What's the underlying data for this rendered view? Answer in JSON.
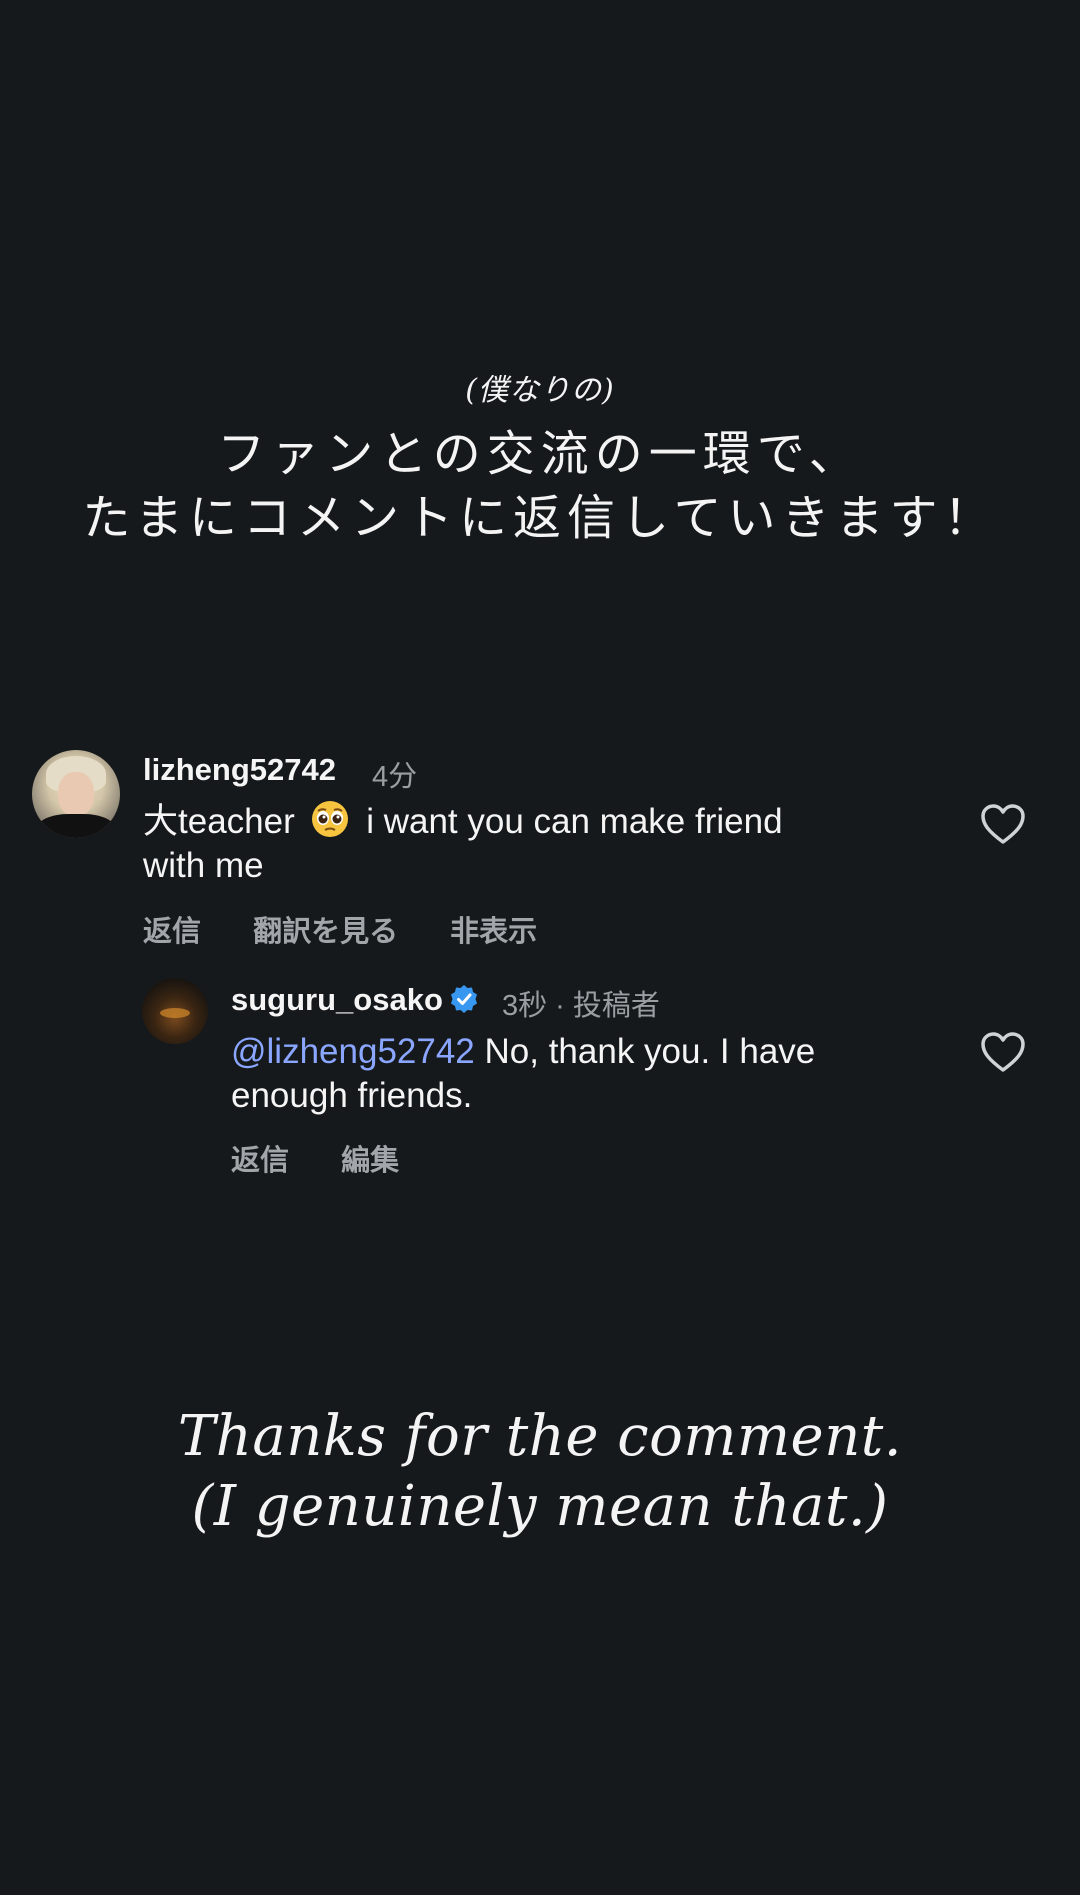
{
  "story": {
    "caption_small": "(僕なりの)",
    "headline_line1": "ファンとの交流の一環で、",
    "headline_line2": "たまにコメントに返信していきます！",
    "bottom_line1": "Thanks for the comment.",
    "bottom_line2": "(I genuinely mean that.)"
  },
  "comment": {
    "username": "lizheng52742",
    "time": "4分",
    "text_before_emoji": "大teacher",
    "emoji": "pleading-face-emoji",
    "text_after_emoji": "i want you can make friend",
    "text_line2": "with me",
    "actions": {
      "reply": "返信",
      "see_translation": "翻訳を見る",
      "hide": "非表示"
    },
    "like_icon": "heart-outline-icon"
  },
  "reply": {
    "username": "suguru_osako",
    "verified_icon": "verified-badge-icon",
    "verified_color": "#3897f0",
    "meta": "3秒 · 投稿者",
    "mention": "@lizheng52742",
    "text_after_mention": "No, thank you. I have",
    "text_line2": "enough friends.",
    "actions": {
      "reply": "返信",
      "edit": "編集"
    },
    "like_icon": "heart-outline-icon"
  },
  "colors": {
    "background": "#15191c",
    "mention": "#8aa6ff",
    "muted_text": "#9a9ea3"
  }
}
